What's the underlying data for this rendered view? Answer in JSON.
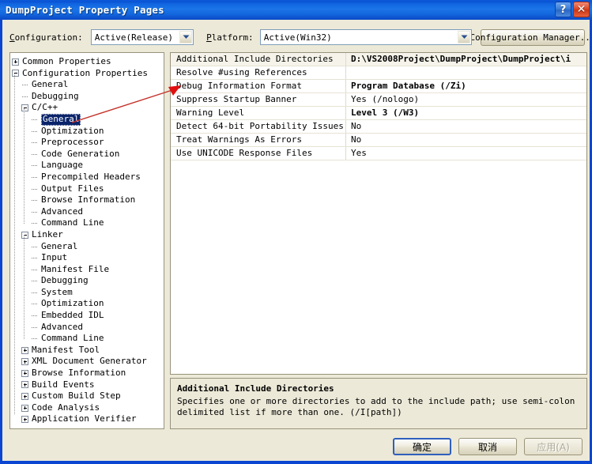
{
  "window": {
    "title": "DumpProject Property Pages",
    "help_button": "?",
    "close_button": "✕"
  },
  "toolbar": {
    "configuration_label": "Configuration:",
    "configuration_value": "Active(Release)",
    "platform_label": "Platform:",
    "platform_value": "Active(Win32)",
    "configuration_manager_label": "Configuration Manager..."
  },
  "tree": {
    "nodes": [
      {
        "label": "Common Properties",
        "depth": 0,
        "toggle": "plus",
        "selected": false
      },
      {
        "label": "Configuration Properties",
        "depth": 0,
        "toggle": "minus",
        "selected": false
      },
      {
        "label": "General",
        "depth": 1,
        "toggle": "none",
        "selected": false
      },
      {
        "label": "Debugging",
        "depth": 1,
        "toggle": "none",
        "selected": false
      },
      {
        "label": "C/C++",
        "depth": 1,
        "toggle": "minus",
        "selected": false
      },
      {
        "label": "General",
        "depth": 2,
        "toggle": "none",
        "selected": true
      },
      {
        "label": "Optimization",
        "depth": 2,
        "toggle": "none",
        "selected": false
      },
      {
        "label": "Preprocessor",
        "depth": 2,
        "toggle": "none",
        "selected": false
      },
      {
        "label": "Code Generation",
        "depth": 2,
        "toggle": "none",
        "selected": false
      },
      {
        "label": "Language",
        "depth": 2,
        "toggle": "none",
        "selected": false
      },
      {
        "label": "Precompiled Headers",
        "depth": 2,
        "toggle": "none",
        "selected": false
      },
      {
        "label": "Output Files",
        "depth": 2,
        "toggle": "none",
        "selected": false
      },
      {
        "label": "Browse Information",
        "depth": 2,
        "toggle": "none",
        "selected": false
      },
      {
        "label": "Advanced",
        "depth": 2,
        "toggle": "none",
        "selected": false
      },
      {
        "label": "Command Line",
        "depth": 2,
        "toggle": "none",
        "selected": false
      },
      {
        "label": "Linker",
        "depth": 1,
        "toggle": "minus",
        "selected": false
      },
      {
        "label": "General",
        "depth": 2,
        "toggle": "none",
        "selected": false
      },
      {
        "label": "Input",
        "depth": 2,
        "toggle": "none",
        "selected": false
      },
      {
        "label": "Manifest File",
        "depth": 2,
        "toggle": "none",
        "selected": false
      },
      {
        "label": "Debugging",
        "depth": 2,
        "toggle": "none",
        "selected": false
      },
      {
        "label": "System",
        "depth": 2,
        "toggle": "none",
        "selected": false
      },
      {
        "label": "Optimization",
        "depth": 2,
        "toggle": "none",
        "selected": false
      },
      {
        "label": "Embedded IDL",
        "depth": 2,
        "toggle": "none",
        "selected": false
      },
      {
        "label": "Advanced",
        "depth": 2,
        "toggle": "none",
        "selected": false
      },
      {
        "label": "Command Line",
        "depth": 2,
        "toggle": "none",
        "selected": false
      },
      {
        "label": "Manifest Tool",
        "depth": 1,
        "toggle": "plus",
        "selected": false
      },
      {
        "label": "XML Document Generator",
        "depth": 1,
        "toggle": "plus",
        "selected": false
      },
      {
        "label": "Browse Information",
        "depth": 1,
        "toggle": "plus",
        "selected": false
      },
      {
        "label": "Build Events",
        "depth": 1,
        "toggle": "plus",
        "selected": false
      },
      {
        "label": "Custom Build Step",
        "depth": 1,
        "toggle": "plus",
        "selected": false
      },
      {
        "label": "Code Analysis",
        "depth": 1,
        "toggle": "plus",
        "selected": false
      },
      {
        "label": "Application Verifier",
        "depth": 1,
        "toggle": "plus",
        "selected": false
      }
    ]
  },
  "grid": {
    "rows": [
      {
        "name": "Additional Include Directories",
        "value": "D:\\VS2008Project\\DumpProject\\DumpProject\\i",
        "bold": true
      },
      {
        "name": "Resolve #using References",
        "value": "",
        "bold": false
      },
      {
        "name": "Debug Information Format",
        "value": "Program Database (/Zi)",
        "bold": true
      },
      {
        "name": "Suppress Startup Banner",
        "value": "Yes (/nologo)",
        "bold": false
      },
      {
        "name": "Warning Level",
        "value": "Level 3 (/W3)",
        "bold": true
      },
      {
        "name": "Detect 64-bit Portability Issues",
        "value": "No",
        "bold": false
      },
      {
        "name": "Treat Warnings As Errors",
        "value": "No",
        "bold": false
      },
      {
        "name": "Use UNICODE Response Files",
        "value": "Yes",
        "bold": false
      }
    ]
  },
  "description": {
    "title": "Additional Include Directories",
    "body": "Specifies one or more directories to add to the include path; use semi-colon delimited list if more than one.     (/I[path])"
  },
  "buttons": {
    "ok": "确定",
    "cancel": "取消",
    "apply": "应用(A)"
  },
  "annotation": {
    "color": "#c4322a",
    "description": "red arrow from selected General tree node to Debug Information Format row"
  },
  "colors": {
    "titlebar_blue": "#1468de",
    "window_border": "#0a46d2",
    "dialog_face": "#ece9d8",
    "selection_navy": "#0a246a",
    "annotation_red": "#c4322a"
  }
}
